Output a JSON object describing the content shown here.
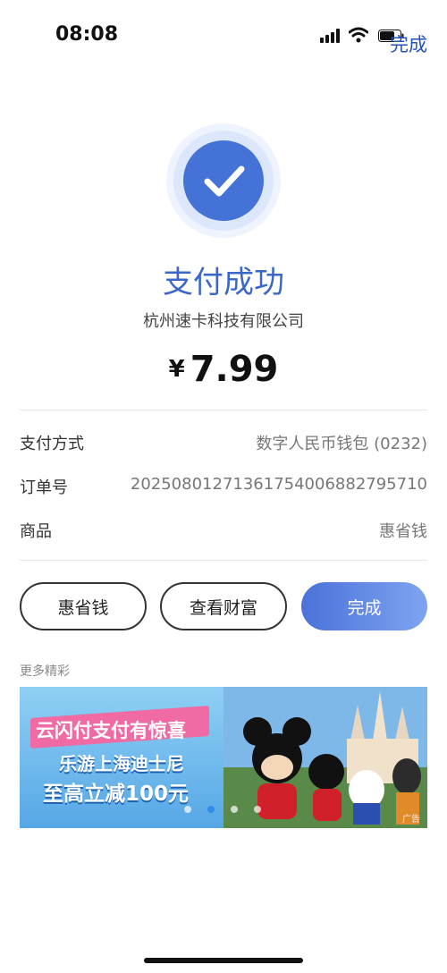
{
  "status_bar": {
    "time": "08:08",
    "nav_done_label": "完成"
  },
  "result": {
    "title": "支付成功",
    "merchant": "杭州速卡科技有限公司",
    "currency": "¥",
    "amount": "7.99"
  },
  "details": [
    {
      "label": "支付方式",
      "value": "数字人民币钱包 (0232)"
    },
    {
      "label": "订单号",
      "value": "2025080127136175400688279571​0"
    },
    {
      "label": "商品",
      "value": "惠省钱"
    }
  ],
  "actions": {
    "btn1": "惠省钱",
    "btn2": "查看财富",
    "btn3": "完成"
  },
  "more": {
    "section_label": "更多精彩",
    "banner": {
      "ribbon": "云闪付支付有惊喜",
      "line1": "乐游上海迪士尼",
      "line2": "至高立减100元",
      "ad_tag": "广告",
      "active_dot_index": 1,
      "dot_count": 4
    }
  },
  "colors": {
    "accent": "#3a67c8",
    "primary_button": "#5b83e3"
  }
}
